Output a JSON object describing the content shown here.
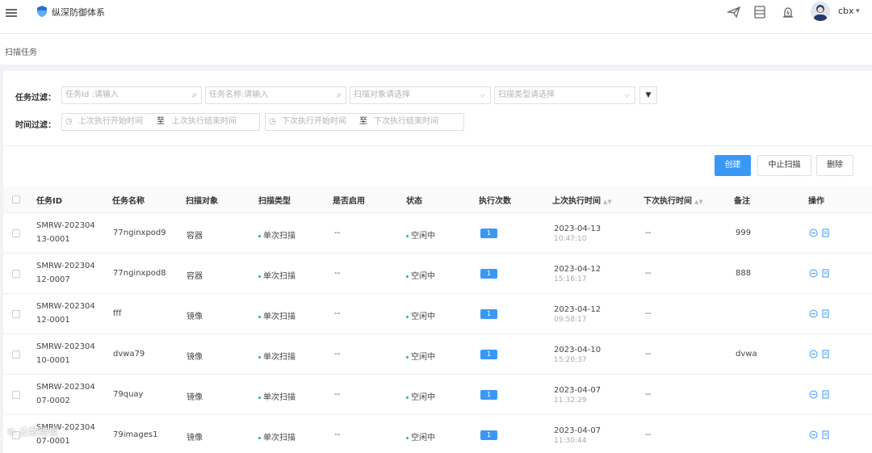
{
  "header": {
    "title": "纵深防御体系",
    "user": "cbx",
    "icons": [
      "menu-icon",
      "shield-logo",
      "send-icon",
      "server-icon",
      "alarm-icon",
      "avatar",
      "chevron-down-icon"
    ]
  },
  "breadcrumb": "扫描任务",
  "filters": {
    "task_label": "任务过滤：",
    "time_label": "时间过滤：",
    "task_id_placeholder": "任务Id :请输入",
    "task_name_placeholder": "任务名称:请输入",
    "scan_target_placeholder": "扫描对象请选择",
    "scan_type_placeholder": "扫描类型请选择",
    "range_sep": "至",
    "last_start_placeholder": "上次执行开始时间",
    "last_end_placeholder": "上次执行结束时间",
    "next_start_placeholder": "下次执行开始时间",
    "next_end_placeholder": "下次执行结束时间"
  },
  "actions": {
    "create": "创建",
    "stop": "中止扫描",
    "delete": "删除"
  },
  "table": {
    "columns": [
      "任务ID",
      "任务名称",
      "扫描对象",
      "扫描类型",
      "是否启用",
      "状态",
      "执行次数",
      "上次执行时间",
      "下次执行时间",
      "备注",
      "操作"
    ],
    "rows": [
      {
        "id1": "SMRW-202304",
        "id2": "13-0001",
        "name": "77nginxpod9",
        "target": "容器",
        "type": "单次扫描",
        "enabled": "--",
        "status": "空闲中",
        "count": "1",
        "last_date": "2023-04-13",
        "last_time": "10:47:10",
        "next": "--",
        "note": "999"
      },
      {
        "id1": "SMRW-202304",
        "id2": "12-0007",
        "name": "77nginxpod8",
        "target": "容器",
        "type": "单次扫描",
        "enabled": "--",
        "status": "空闲中",
        "count": "1",
        "last_date": "2023-04-12",
        "last_time": "15:16:17",
        "next": "--",
        "note": "888"
      },
      {
        "id1": "SMRW-202304",
        "id2": "12-0001",
        "name": "fff",
        "target": "镜像",
        "type": "单次扫描",
        "enabled": "--",
        "status": "空闲中",
        "count": "1",
        "last_date": "2023-04-12",
        "last_time": "09:58:17",
        "next": "--",
        "note": ""
      },
      {
        "id1": "SMRW-202304",
        "id2": "10-0001",
        "name": "dvwa79",
        "target": "镜像",
        "type": "单次扫描",
        "enabled": "--",
        "status": "空闲中",
        "count": "1",
        "last_date": "2023-04-10",
        "last_time": "15:20:37",
        "next": "--",
        "note": "dvwa"
      },
      {
        "id1": "SMRW-202304",
        "id2": "07-0002",
        "name": "79quay",
        "target": "镜像",
        "type": "单次扫描",
        "enabled": "--",
        "status": "空闲中",
        "count": "1",
        "last_date": "2023-04-07",
        "last_time": "11:32:29",
        "next": "--",
        "note": ""
      },
      {
        "id1": "SMRW-202304",
        "id2": "07-0001",
        "name": "79images1",
        "target": "镜像",
        "type": "单次扫描",
        "enabled": "--",
        "status": "空闲中",
        "count": "1",
        "last_date": "2023-04-07",
        "last_time": "11:30:44",
        "next": "--",
        "note": ""
      }
    ]
  },
  "watermark": "© 云数跨境",
  "colors": {
    "primary": "#3a98f5",
    "status_dot": "#2ab0a6"
  }
}
